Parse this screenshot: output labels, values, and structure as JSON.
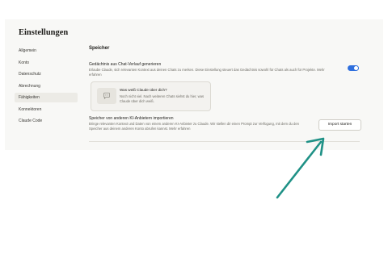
{
  "header": {
    "title": "Einstellungen"
  },
  "sidebar": {
    "items": [
      {
        "label": "Allgemein"
      },
      {
        "label": "Konto"
      },
      {
        "label": "Datenschutz"
      },
      {
        "label": "Abrechnung"
      },
      {
        "label": "Fähigkeiten",
        "active": true
      },
      {
        "label": "Konnektoren"
      },
      {
        "label": "Claude Code"
      }
    ]
  },
  "main": {
    "section_title": "Speicher",
    "memory_setting": {
      "label": "Gedächtnis aus Chat-Verlauf generieren",
      "description": "Erlaube Claude, sich relevanten Kontext aus deinen Chats zu merken. Diese Einstellung steuert das Gedächtnis sowohl für Chats als auch für Projekte. Mehr erfahren",
      "enabled": true
    },
    "memory_card": {
      "title": "Was weiß Claude über dich?",
      "description": "Noch nicht viel. Nach weiteren Chats siehst du hier, was Claude über dich weiß."
    },
    "import_setting": {
      "label": "Speicher von anderen KI-Anbietern importieren",
      "description": "Bringe relevanten Kontext und Daten von einem anderen KI-Anbieter zu Claude. Wir stellen dir einen Prompt zur Verfügung, mit dem du den Speicher aus deinem anderen Konto abrufen kannst. Mehr erfahren",
      "button_label": "Import starten"
    }
  },
  "colors": {
    "toggle_on": "#2f6fde",
    "arrow": "#1f9186",
    "panel_bg": "#f8f8f6"
  }
}
